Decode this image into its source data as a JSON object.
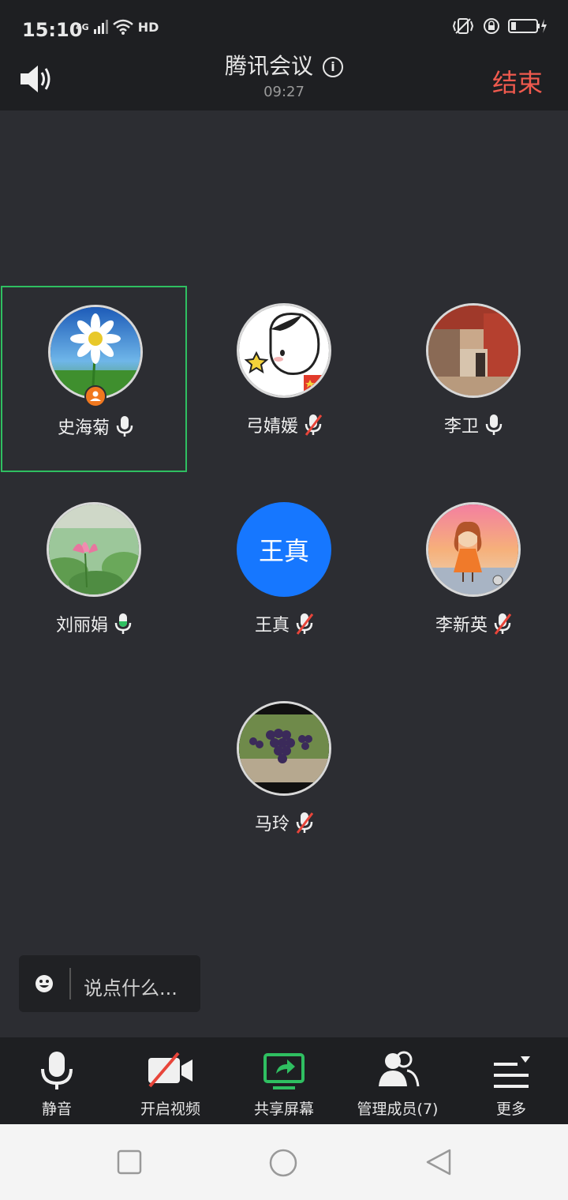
{
  "status_bar": {
    "time": "15:10",
    "network_label": "4G",
    "hd_label": "HD",
    "icons": [
      "signal-icon",
      "wifi-icon",
      "vibrate-icon",
      "lock-rotation-icon",
      "battery-icon"
    ]
  },
  "header": {
    "title": "腾讯会议",
    "timer": "09:27",
    "end_label": "结束"
  },
  "participants": [
    {
      "name": "史海菊",
      "mic": "on",
      "host": true,
      "active_speaker": true,
      "avatar": "daisy-photo"
    },
    {
      "name": "弓婧媛",
      "mic": "muted",
      "host": false,
      "active_speaker": false,
      "avatar": "cartoon-girl"
    },
    {
      "name": "李卫",
      "mic": "on",
      "host": false,
      "active_speaker": false,
      "avatar": "temple-photo"
    },
    {
      "name": "刘丽娟",
      "mic": "speaking",
      "host": false,
      "active_speaker": false,
      "avatar": "lotus-photo"
    },
    {
      "name": "王真",
      "mic": "muted",
      "host": false,
      "active_speaker": false,
      "avatar_text": "王真"
    },
    {
      "name": "李新英",
      "mic": "muted",
      "host": false,
      "active_speaker": false,
      "avatar": "painted-girl"
    },
    {
      "name": "马玲",
      "mic": "muted",
      "host": false,
      "active_speaker": false,
      "avatar": "grapes-photo"
    }
  ],
  "chat": {
    "placeholder": "说点什么..."
  },
  "toolbar": {
    "mute_label": "静音",
    "video_label": "开启视频",
    "share_label": "共享屏幕",
    "members_label": "管理成员(7)",
    "more_label": "更多"
  },
  "colors": {
    "end": "#f05a4e",
    "active_border": "#2fbf61",
    "host_badge": "#f1781f",
    "avatar_blue": "#1677ff",
    "share_green": "#2fbf61"
  }
}
